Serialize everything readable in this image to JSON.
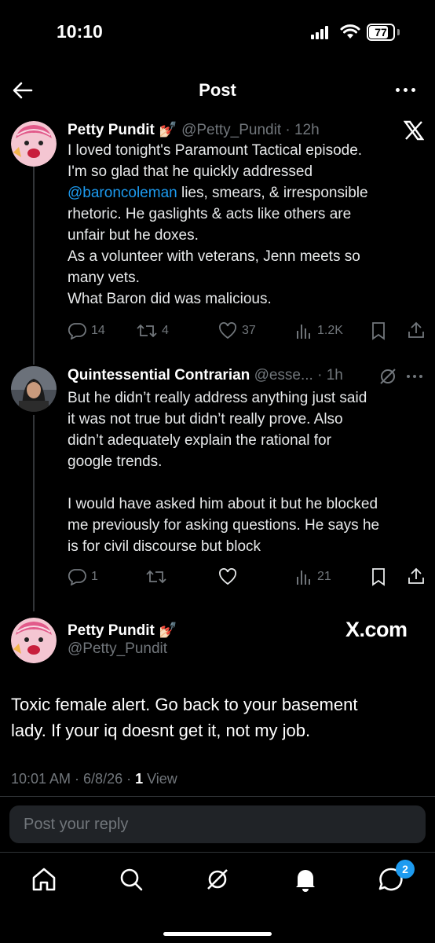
{
  "status_bar": {
    "time": "10:10",
    "battery_level": "77"
  },
  "header": {
    "title": "Post",
    "back_icon": "arrow-left-icon",
    "more_icon": "more-dots-icon"
  },
  "thread": [
    {
      "name": "Petty Pundit",
      "name_emoji": "💅🏻",
      "handle_time": "@Petty_Pundit · 12h",
      "source_icon": "x-logo-icon",
      "lines": [
        "I loved tonight's Paramount Tactical episode.",
        "I'm so glad that he quickly addressed",
        "",
        "rhetoric. He gaslights & acts like others are",
        "unfair but he doxes.",
        "As a volunteer with veterans, Jenn meets so",
        "many vets.",
        "What Baron did was malicious."
      ],
      "mention": "@baroncoleman",
      "mention_rest": " lies, smears, & irresponsible",
      "replies": "14",
      "reposts": "4",
      "likes": "37",
      "views": "1.2K"
    },
    {
      "name": "Quintessential Contrarian",
      "handle_time": "@esse... · 1h",
      "source_icon": "grok-icon",
      "lines": [
        "But he didn’t really address anything just said",
        "it was not true but didn’t really prove. Also",
        "didn’t adequately explain the rational for",
        "google trends.",
        "",
        "I would have asked him about it but he blocked",
        "me previously for asking questions. He says he",
        "is for civil discourse but block"
      ],
      "replies": "1",
      "reposts": "",
      "likes": "",
      "views": "21"
    }
  ],
  "main_post": {
    "name": "Petty Pundit",
    "name_emoji": "💅🏻",
    "handle": "@Petty_Pundit",
    "source_label": "X.com",
    "text_line1": "Toxic female alert. Go back to your basement",
    "text_line2": "lady. If your iq doesnt get it, not my job.",
    "time_date": "10:01 AM · 6/8/26 · ",
    "view_count": "1",
    "view_label": " View"
  },
  "reply": {
    "placeholder": "Post your reply"
  },
  "tabbar": {
    "items": [
      "home-icon",
      "search-icon",
      "grok-icon",
      "notifications-icon",
      "messages-icon"
    ],
    "messages_badge": "2"
  },
  "colors": {
    "background": "#000000",
    "accent": "#1d9bf0",
    "muted": "#71767b",
    "text": "#e7e9ea"
  }
}
